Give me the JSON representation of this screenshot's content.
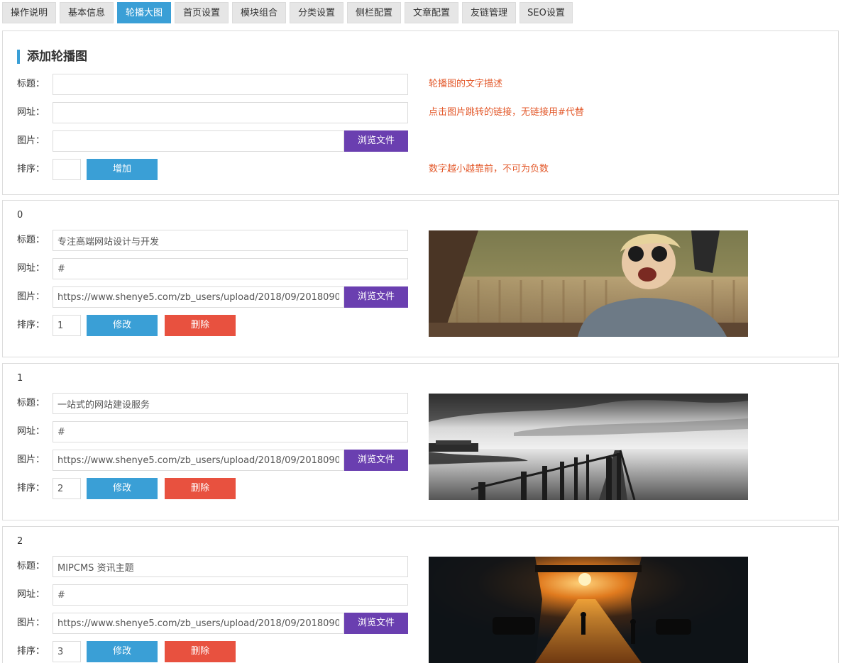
{
  "tabs": [
    "操作说明",
    "基本信息",
    "轮播大图",
    "首页设置",
    "模块组合",
    "分类设置",
    "侧栏配置",
    "文章配置",
    "友链管理",
    "SEO设置"
  ],
  "add_form": {
    "title": "添加轮播图",
    "labels": {
      "title": "标题：",
      "url": "网址：",
      "image": "图片：",
      "order": "排序："
    },
    "values": {
      "title": "",
      "url": "",
      "image": "",
      "order": ""
    },
    "hints": {
      "title": "轮播图的文字描述",
      "url": "点击图片跳转的链接，无链接用#代替",
      "order": "数字越小越靠前，不可为负数"
    },
    "browse_label": "浏览文件",
    "add_label": "增加"
  },
  "labels": {
    "title": "标题：",
    "url": "网址：",
    "image": "图片：",
    "order": "排序："
  },
  "buttons": {
    "browse": "浏览文件",
    "edit": "修改",
    "delete": "删除"
  },
  "items": [
    {
      "index": "0",
      "title": "专注高端网站设计与开发",
      "url": "#",
      "image": "https://www.shenye5.com/zb_users/upload/2018/09/20180905151",
      "order": "1",
      "preview_icon": "girl-sunglasses-photo"
    },
    {
      "index": "1",
      "title": "一站式的网站建设服务",
      "url": "#",
      "image": "https://www.shenye5.com/zb_users/upload/2018/09/20180905151",
      "order": "2",
      "preview_icon": "pier-lake-photo"
    },
    {
      "index": "2",
      "title": "MIPCMS 资讯主题",
      "url": "#",
      "image": "https://www.shenye5.com/zb_users/upload/2018/09/20180905151",
      "order": "3",
      "preview_icon": "city-sunset-photo"
    }
  ],
  "colors": {
    "tab_active": "#3a9fd6",
    "browse": "#6a3fb0",
    "primary": "#3a9fd6",
    "danger": "#e8513f",
    "hint": "#e35a2c"
  }
}
